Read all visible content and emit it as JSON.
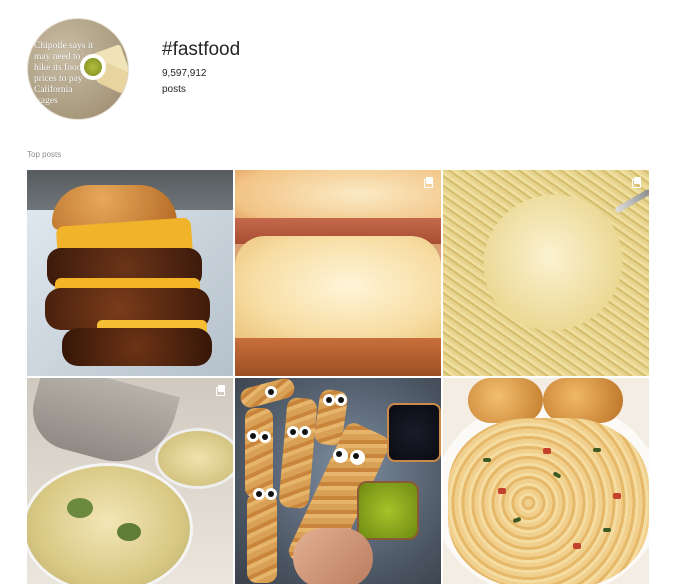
{
  "hashtag": {
    "title": "#fastfood",
    "post_count": "9,597,912",
    "post_word": "posts"
  },
  "avatar": {
    "caption": "Chipotle says it may need to hike its food prices to pay California wages"
  },
  "section": {
    "label": "Top posts"
  },
  "posts": [
    {
      "subject": "stacked cheeseburger",
      "multi": false
    },
    {
      "subject": "melted cheese sandwich",
      "multi": true
    },
    {
      "subject": "spaghetti on fork",
      "multi": true
    },
    {
      "subject": "broccoli mac and cheese",
      "multi": true
    },
    {
      "subject": "pastry mummy dogs",
      "multi": false
    },
    {
      "subject": "creamy rotini pasta",
      "multi": false
    }
  ],
  "colors": {
    "text": "#262626",
    "secondary_text": "#8e8e8e",
    "background": "#ffffff"
  }
}
